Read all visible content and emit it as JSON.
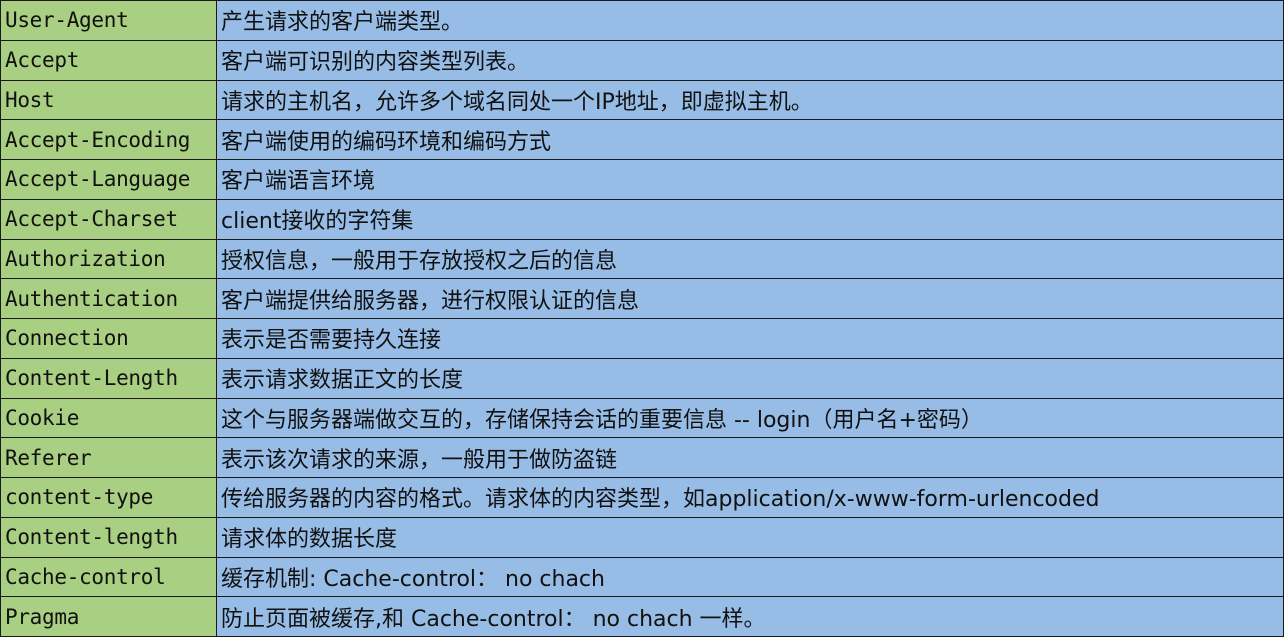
{
  "table": {
    "rows": [
      {
        "name": "User-Agent",
        "desc": "产生请求的客户端类型。"
      },
      {
        "name": "Accept",
        "desc": "客户端可识别的内容类型列表。"
      },
      {
        "name": "Host",
        "desc": "请求的主机名，允许多个域名同处一个IP地址，即虚拟主机。"
      },
      {
        "name": "Accept-Encoding",
        "desc": "客户端使用的编码环境和编码方式"
      },
      {
        "name": "Accept-Language",
        "desc": "客户端语言环境"
      },
      {
        "name": "Accept-Charset",
        "desc": "client接收的字符集"
      },
      {
        "name": "Authorization",
        "desc": "授权信息，一般用于存放授权之后的信息"
      },
      {
        "name": "Authentication",
        "desc": "客户端提供给服务器，进行权限认证的信息"
      },
      {
        "name": "Connection",
        "desc": "表示是否需要持久连接"
      },
      {
        "name": "Content-Length",
        "desc": "表示请求数据正文的长度"
      },
      {
        "name": "Cookie",
        "desc": "这个与服务器端做交互的，存储保持会话的重要信息 -- login（用户名+密码）"
      },
      {
        "name": "Referer",
        "desc": "表示该次请求的来源，一般用于做防盗链"
      },
      {
        "name": "content-type",
        "desc": "传给服务器的内容的格式。请求体的内容类型，如application/x-www-form-urlencoded"
      },
      {
        "name": "Content-length",
        "desc": "请求体的数据长度"
      },
      {
        "name": "Cache-control",
        "desc": "缓存机制: Cache-control： no chach"
      },
      {
        "name": "Pragma",
        "desc": "防止页面被缓存,和 Cache-control： no chach 一样。"
      }
    ]
  }
}
